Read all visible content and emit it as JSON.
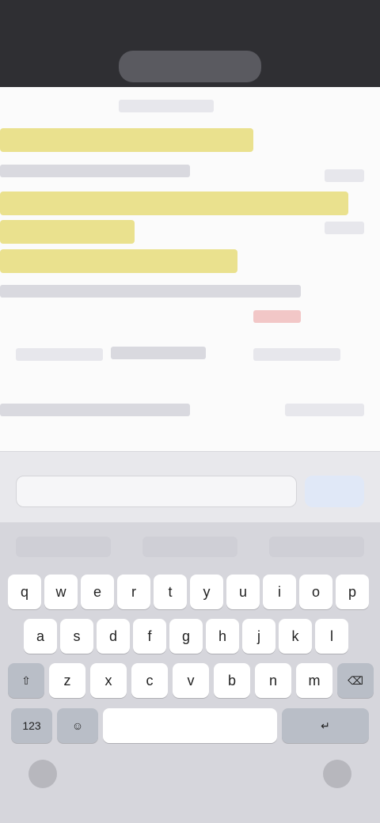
{
  "status": {
    "time": "",
    "icons": ""
  },
  "url_pill": {
    "label": ""
  },
  "content": {
    "highlight_count": 4
  },
  "toolbar": {
    "find_placeholder": "",
    "done_label": ""
  },
  "keyboard": {
    "row1": [
      "q",
      "w",
      "e",
      "r",
      "t",
      "y",
      "u",
      "i",
      "o",
      "p"
    ],
    "row2": [
      "a",
      "s",
      "d",
      "f",
      "g",
      "h",
      "j",
      "k",
      "l"
    ],
    "row3": [
      "⇧",
      "z",
      "x",
      "c",
      "v",
      "b",
      "n",
      "m",
      "⌫"
    ],
    "row4": {
      "left": "123",
      "emoji": "☺",
      "space": "",
      "return": "↵"
    }
  },
  "colors": {
    "status_bg": "#2f2f33",
    "highlight": "#e6dc7a",
    "accent": "#2f6fd1"
  }
}
